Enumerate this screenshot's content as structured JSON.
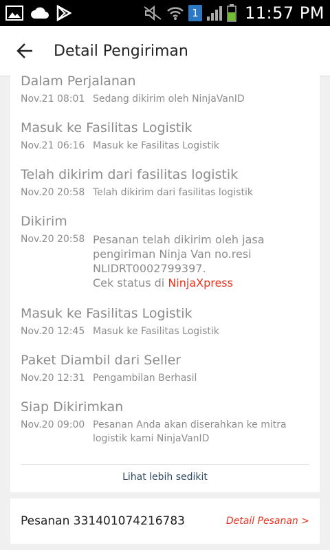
{
  "status_bar": {
    "time": "11:57 PM",
    "notification_count": "1",
    "icons": [
      "gallery-icon",
      "cloud-icon",
      "play-store-icon",
      "mute-icon",
      "wifi-icon",
      "signal-icon",
      "battery-icon"
    ]
  },
  "header": {
    "title": "Detail Pengiriman"
  },
  "timeline": [
    {
      "title": "Dalam Perjalanan",
      "time": "Nov.21 08:01",
      "desc": "Sedang dikirim oleh NinjaVanID"
    },
    {
      "title": "Masuk ke Fasilitas Logistik",
      "time": "Nov.21 06:16",
      "desc": "Masuk ke Fasilitas Logistik"
    },
    {
      "title": "Telah dikirim dari fasilitas logistik",
      "time": "Nov.20 20:58",
      "desc": "Telah dikirim dari fasilitas logistik"
    },
    {
      "title": "Dikirim",
      "time": "Nov.20 20:58",
      "desc_lines": [
        "Pesanan telah dikirim oleh jasa",
        "pengiriman Ninja Van no.resi",
        "NLIDRT0002799397."
      ],
      "status_prefix": "Cek status di ",
      "status_link": "NinjaXpress"
    },
    {
      "title": "Masuk ke Fasilitas Logistik",
      "time": "Nov.20 12:45",
      "desc": "Masuk ke Fasilitas Logistik"
    },
    {
      "title": "Paket Diambil dari Seller",
      "time": "Nov.20 12:31",
      "desc": "Pengambilan Berhasil"
    },
    {
      "title": "Siap Dikirimkan",
      "time": "Nov.20 09:00",
      "desc_lines": [
        "Pesanan Anda akan diserahkan ke mitra",
        "logistik kami NinjaVanID"
      ]
    }
  ],
  "see_less_label": "Lihat lebih sedikit",
  "order": {
    "label": "Pesanan 331401074216783",
    "detail_link": "Detail Pesanan >"
  },
  "colors": {
    "accent": "#e8341c",
    "muted_text": "#8c8c8c",
    "link_blue": "#2e4a66"
  }
}
